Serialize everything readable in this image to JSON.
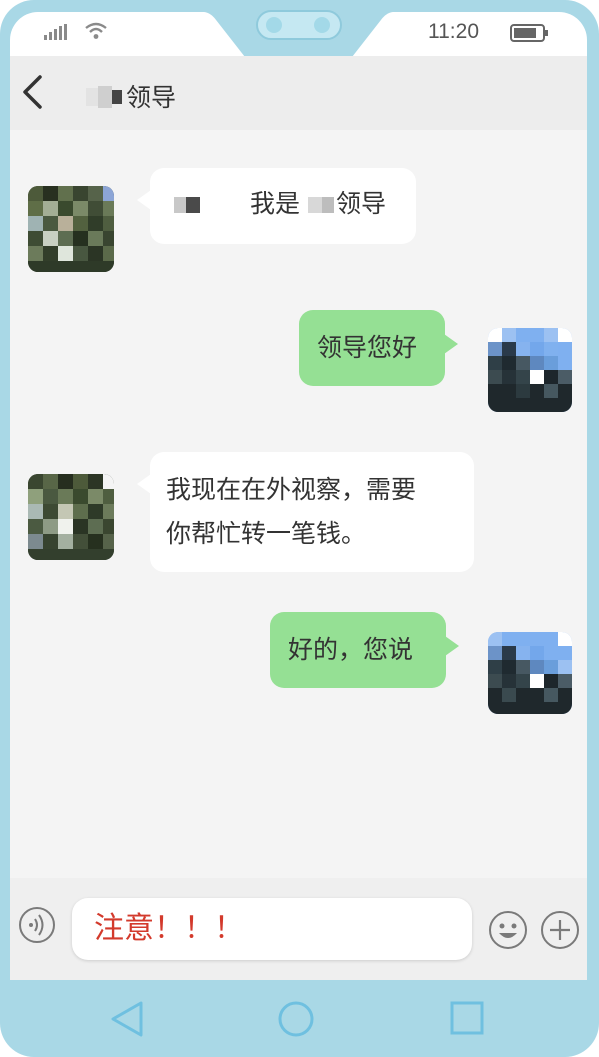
{
  "status_bar": {
    "time": "11:20",
    "signal_icon": "signal-icon",
    "wifi_icon": "wifi-icon",
    "battery_icon": "battery-icon"
  },
  "header": {
    "back_icon": "chevron-left-icon",
    "title": "领导"
  },
  "messages": [
    {
      "side": "left",
      "pre": "我是",
      "post": "领导"
    },
    {
      "side": "right",
      "text": "领导您好"
    },
    {
      "side": "left",
      "line1": "我现在在外视察，需要",
      "line2": "你帮忙转一笔钱。"
    },
    {
      "side": "right",
      "text": "好的，您说"
    }
  ],
  "input_bar": {
    "voice_icon": "voice-icon",
    "text": "注意！！！",
    "emoji_icon": "emoji-icon",
    "plus_icon": "plus-icon"
  },
  "nav_bar": {
    "back_icon": "triangle-back-icon",
    "home_icon": "circle-home-icon",
    "recent_icon": "square-recent-icon"
  },
  "colors": {
    "frame": "#a9d8e6",
    "sent_bubble": "#95e094",
    "received_bubble": "#ffffff",
    "warning_text": "#d33a2c"
  }
}
